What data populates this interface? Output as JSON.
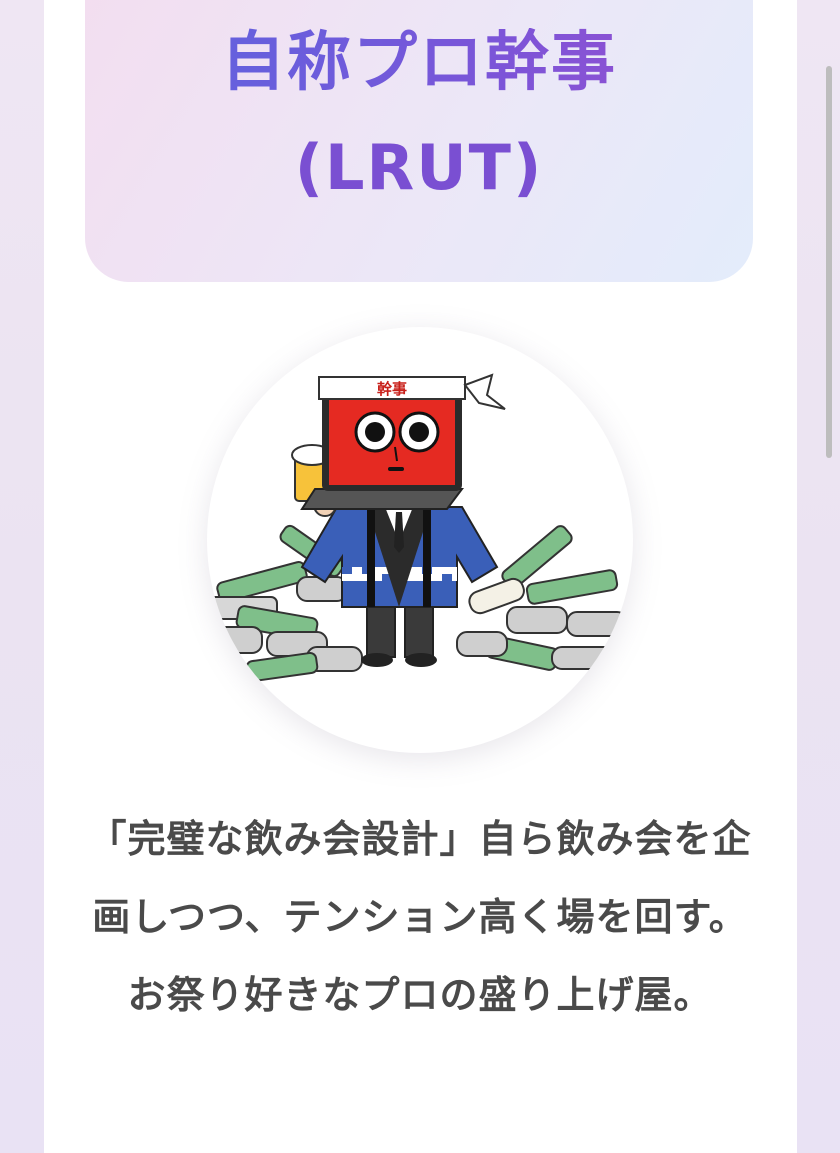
{
  "profile": {
    "title": "自称プロ幹事",
    "handle": "(LRUT)",
    "headband_text": "幹事",
    "description": "「完璧な飲み会設計」自ら飲み会を企画しつつ、テンション高く場を回す。お祭り好きなプロの盛り上げ屋。"
  },
  "colors": {
    "title_gradient_start": "#5a66e0",
    "title_gradient_end": "#9a4fd0",
    "handle": "#7a4fd2",
    "text": "#4a4a4a"
  }
}
